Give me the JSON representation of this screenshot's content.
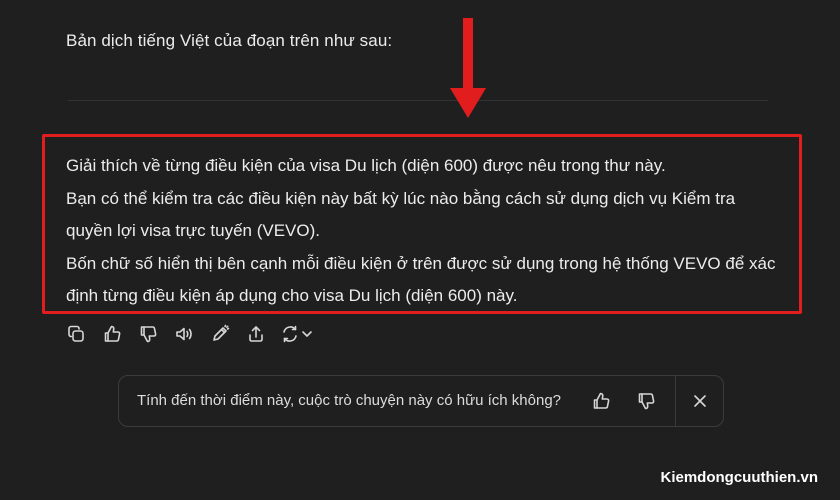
{
  "intro_text": "Bản dịch tiếng Việt của đoạn trên như sau:",
  "answer": {
    "lines": [
      "Giải thích về từng điều kiện của visa Du lịch (diện 600) được nêu trong thư này.",
      "Bạn có thể kiểm tra các điều kiện này bất kỳ lúc nào bằng cách sử dụng dịch vụ Kiểm tra quyền lợi visa trực tuyến (VEVO).",
      "Bốn chữ số hiển thị bên cạnh mỗi điều kiện ở trên được sử dụng trong hệ thống VEVO để xác định từng điều kiện áp dụng cho visa Du lịch (diện 600) này."
    ]
  },
  "actions": {
    "icons": [
      "copy-icon",
      "thumbs-up-icon",
      "thumbs-down-icon",
      "read-aloud-icon",
      "edit-icon",
      "share-icon",
      "regenerate-icon"
    ]
  },
  "feedback": {
    "question": "Tính đến thời điểm này, cuộc trò chuyện này có hữu ích không?",
    "icons": [
      "thumbs-up-icon",
      "thumbs-down-icon",
      "close-icon"
    ]
  },
  "watermark": "Kiemdongcuuthien.vn",
  "colors": {
    "background": "#1f1f1f",
    "highlight": "#e11d1d",
    "arrow": "#e11d1d",
    "text": "#ececec"
  }
}
